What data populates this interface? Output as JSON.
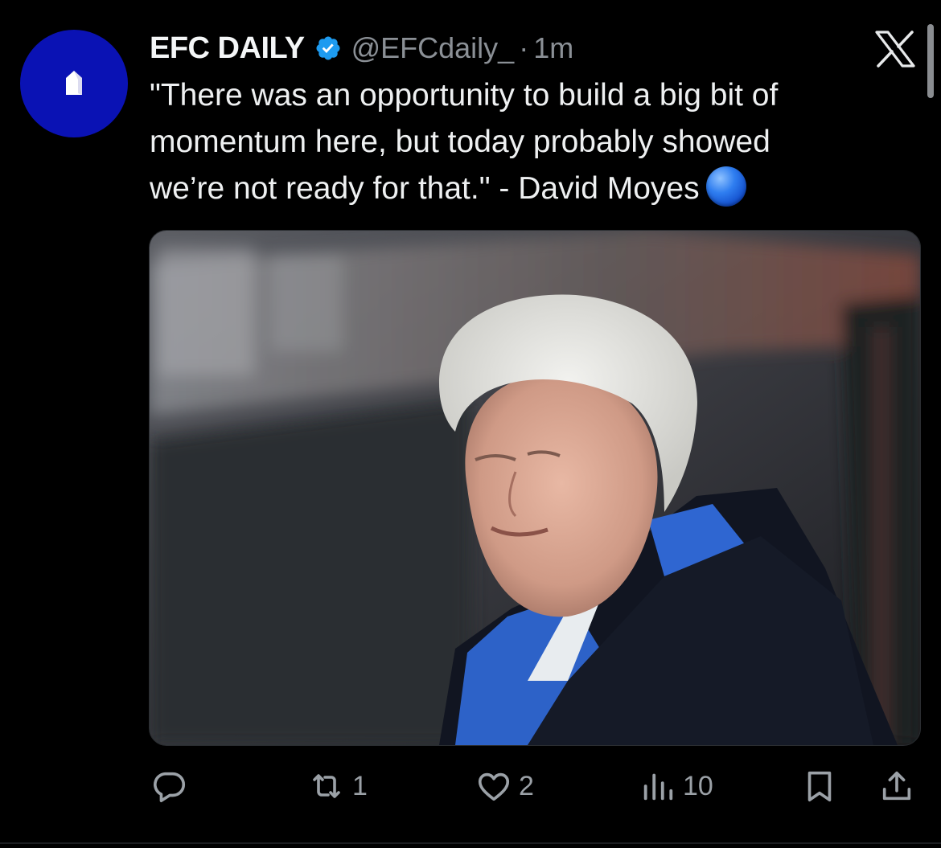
{
  "tweet": {
    "author": {
      "display_name": "EFC DAILY",
      "handle": "@EFCdaily_",
      "verified": true,
      "avatar_color": "#0a12b4",
      "avatar_icon": "white-house-shape-icon"
    },
    "separator": "·",
    "time": "1m",
    "text_lines": [
      "\"There was an opportunity to build a big bit of",
      "momentum here, but today probably showed",
      "we’re not ready for that.\" - David Moyes"
    ],
    "emoji": "blue-circle",
    "media": {
      "type": "photo",
      "alt": ""
    },
    "actions": {
      "reply": {
        "icon": "reply-icon",
        "count": ""
      },
      "repost": {
        "icon": "repost-icon",
        "count": "1"
      },
      "like": {
        "icon": "heart-icon",
        "count": "2"
      },
      "views": {
        "icon": "views-chart-icon",
        "count": "10"
      },
      "bookmark": {
        "icon": "bookmark-icon"
      },
      "share": {
        "icon": "share-icon"
      }
    }
  },
  "colors": {
    "background": "#000000",
    "text": "#eef0f1",
    "muted": "#8b9096",
    "verified_blue": "#1d9bf0"
  }
}
